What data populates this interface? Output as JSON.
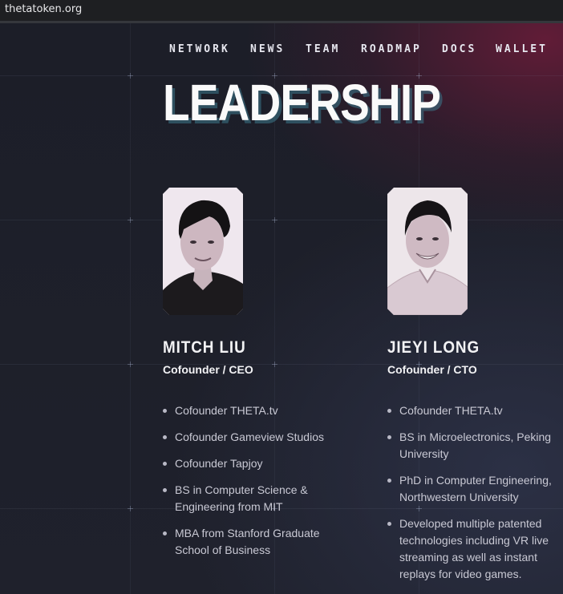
{
  "browser": {
    "url": "thetatoken.org"
  },
  "nav": {
    "items": [
      "NETWORK",
      "NEWS",
      "TEAM",
      "ROADMAP",
      "DOCS",
      "WALLET"
    ]
  },
  "section": {
    "title": "LEADERSHIP"
  },
  "people": [
    {
      "name": "MITCH LIU",
      "role": "Cofounder / CEO",
      "bullets": [
        "Cofounder THETA.tv",
        "Cofounder Gameview Studios",
        "Cofounder Tapjoy",
        "BS in Computer Science & Engineering from MIT",
        "MBA from Stanford Graduate School of Business"
      ]
    },
    {
      "name": "JIEYI LONG",
      "role": "Cofounder / CTO",
      "bullets": [
        "Cofounder THETA.tv",
        "BS in Microelectronics, Peking University",
        "PhD in Computer Engineering, Northwestern University",
        "Developed multiple patented technologies including VR live streaming as well as instant replays for video games."
      ]
    }
  ],
  "colors": {
    "accent_glow": "#781c3c",
    "background": "#1b1d27",
    "text": "#f2f2f4",
    "muted_text": "#c9c9d4"
  }
}
